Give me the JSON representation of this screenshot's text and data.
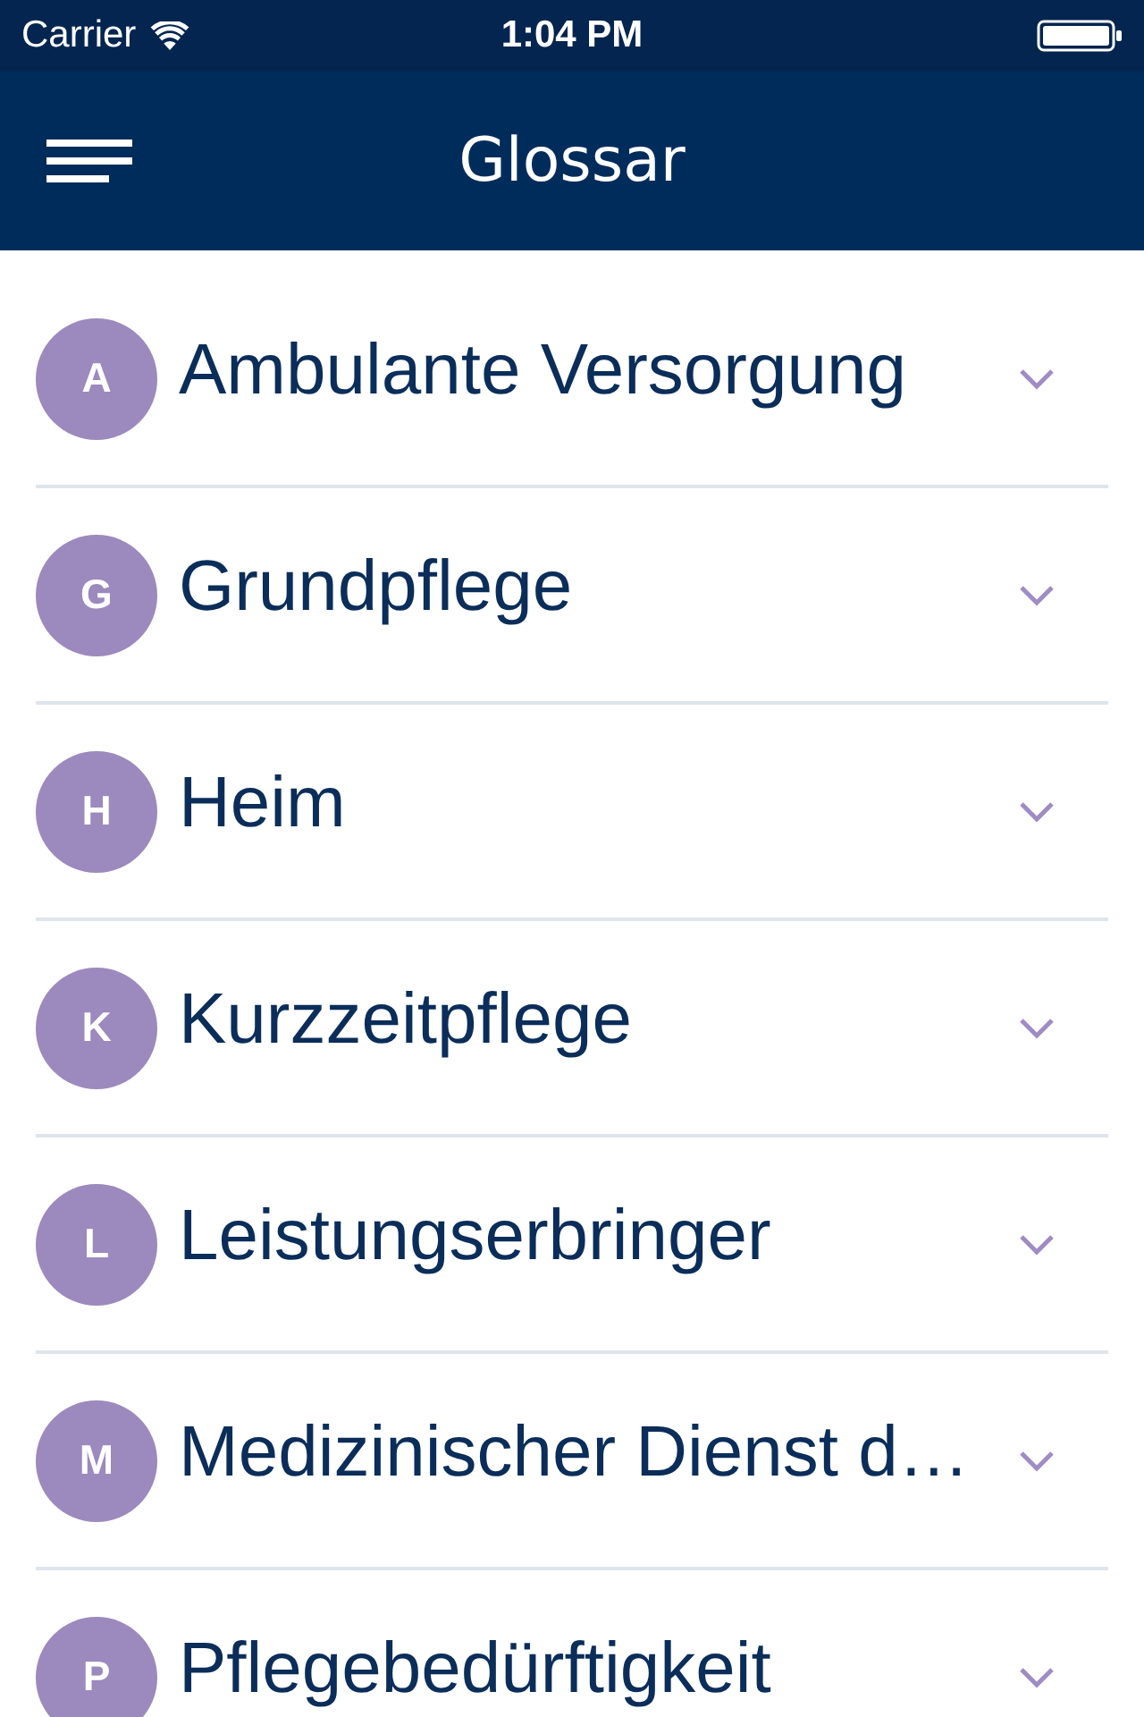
{
  "status_bar": {
    "carrier": "Carrier",
    "time": "1:04 PM"
  },
  "nav_bar": {
    "title": "Glossar"
  },
  "glossary": [
    {
      "letter": "A",
      "term": "Ambulante Versorgung",
      "expanded": false
    },
    {
      "letter": "G",
      "term": "Grundpflege",
      "expanded": false
    },
    {
      "letter": "H",
      "term": "Heim",
      "expanded": false
    },
    {
      "letter": "K",
      "term": "Kurzzeitpflege",
      "expanded": false
    },
    {
      "letter": "L",
      "term": "Leistungserbringer",
      "expanded": false
    },
    {
      "letter": "M",
      "term": "Medizinischer Dienst d…",
      "expanded": false
    },
    {
      "letter": "P",
      "term": "Pflegebedürftigkeit",
      "expanded": false
    }
  ]
}
